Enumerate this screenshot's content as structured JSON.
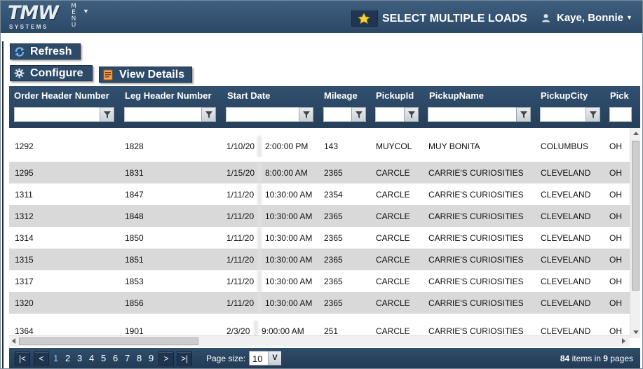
{
  "header": {
    "logo_main": "TMW",
    "logo_sub": "SYSTEMS",
    "menu_label": [
      "M",
      "E",
      "N",
      "U"
    ],
    "page_title": "SELECT MULTIPLE LOADS",
    "user_name": "Kaye, Bonnie"
  },
  "toolbar": {
    "refresh_label": "Refresh",
    "configure_label": "Configure",
    "view_details_label": "View Details"
  },
  "grid": {
    "columns": [
      "Order Header Number",
      "Leg Header Number",
      "Start Date",
      "Mileage",
      "PickupId",
      "PickupName",
      "PickupCity",
      "Pick"
    ],
    "rows": [
      [
        "1292",
        "1828",
        "1/10/20",
        "2:00:00 PM",
        "143",
        "MUYCOL",
        "MUY BONITA",
        "COLUMBUS",
        "OH"
      ],
      [
        "1295",
        "1831",
        "1/15/20",
        "8:00:00 AM",
        "2365",
        "CARCLE",
        "CARRIE'S CURIOSITIES",
        "CLEVELAND",
        "OH"
      ],
      [
        "1311",
        "1847",
        "1/11/20",
        "10:30:00 AM",
        "2354",
        "CARCLE",
        "CARRIE'S CURIOSITIES",
        "CLEVELAND",
        "OH"
      ],
      [
        "1312",
        "1848",
        "1/11/20",
        "10:30:00 AM",
        "2365",
        "CARCLE",
        "CARRIE'S CURIOSITIES",
        "CLEVELAND",
        "OH"
      ],
      [
        "1314",
        "1850",
        "1/11/20",
        "10:30:00 AM",
        "2365",
        "CARCLE",
        "CARRIE'S CURIOSITIES",
        "CLEVELAND",
        "OH"
      ],
      [
        "1315",
        "1851",
        "1/11/20",
        "10:30:00 AM",
        "2365",
        "CARCLE",
        "CARRIE'S CURIOSITIES",
        "CLEVELAND",
        "OH"
      ],
      [
        "1317",
        "1853",
        "1/11/20",
        "10:30:00 AM",
        "2365",
        "CARCLE",
        "CARRIE'S CURIOSITIES",
        "CLEVELAND",
        "OH"
      ],
      [
        "1320",
        "1856",
        "1/11/20",
        "10:30:00 AM",
        "2365",
        "CARCLE",
        "CARRIE'S CURIOSITIES",
        "CLEVELAND",
        "OH"
      ],
      [
        "1364",
        "1901",
        "2/3/20",
        "9:00:00 AM",
        "251",
        "CARCLE",
        "CARRIE'S CURIOSITIES",
        "CLEVELAND",
        "OH"
      ]
    ]
  },
  "pager": {
    "first": "|<",
    "prev": "<",
    "next": ">",
    "last": ">|",
    "pages": [
      "1",
      "2",
      "3",
      "4",
      "5",
      "6",
      "7",
      "8",
      "9"
    ],
    "page_size_label": "Page size:",
    "page_size": "10",
    "page_size_arrow": "V",
    "total_items": "84",
    "items_in": "items in",
    "total_pages": "9",
    "pages_word": "pages"
  },
  "colors": {
    "header_bg": "#2f4d6b",
    "alt_row": "#d9d9d9",
    "current_page": "#8fc3ef"
  },
  "icons": [
    "star-icon",
    "user-icon",
    "refresh-icon",
    "gear-icon",
    "document-icon",
    "filter-icon"
  ]
}
